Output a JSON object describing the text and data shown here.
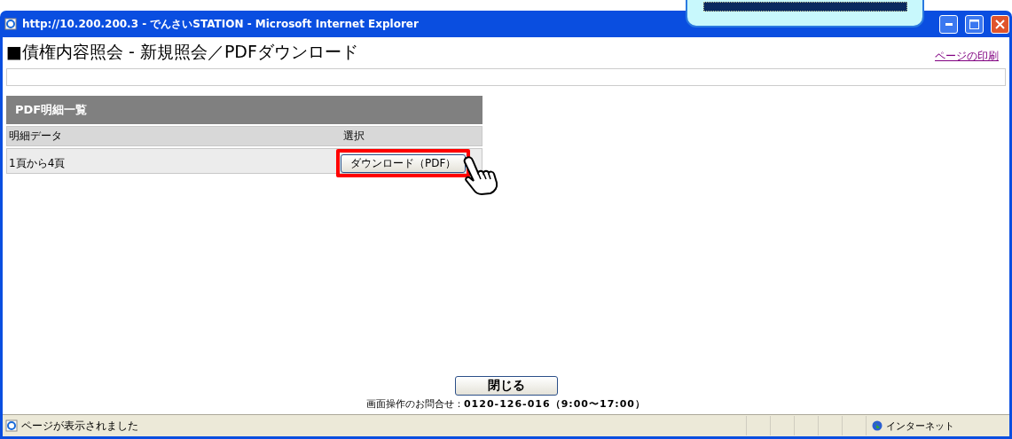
{
  "window": {
    "title": "http://10.200.200.3 - でんさいSTATION - Microsoft Internet Explorer"
  },
  "page": {
    "heading": "■債権内容照会 - 新規照会／PDFダウンロード",
    "print_link": "ページの印刷"
  },
  "table": {
    "title": "PDF明細一覧",
    "columns": [
      "明細データ",
      "選択"
    ],
    "rows": [
      {
        "label": "1頁から4頁",
        "button": "ダウンロード（PDF）",
        "highlighted": true
      }
    ]
  },
  "close_button": "閉じる",
  "contact": {
    "label": "画面操作のお問合せ：",
    "value": "0120-126-016（9:00〜17:00）"
  },
  "status_bar": {
    "message": "ページが表示されました",
    "zone": "インターネット"
  }
}
